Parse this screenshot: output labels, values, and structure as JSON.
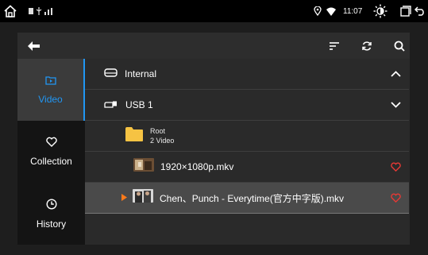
{
  "status_bar": {
    "home_icon": "home-icon",
    "notif_icons": [
      "sim-icon",
      "usb-icon",
      "signal-icon"
    ],
    "location_icon": "location-icon",
    "wifi_icon": "wifi-icon",
    "time": "11:07",
    "brightness_icon": "brightness-icon",
    "window_icon": "window-icon",
    "back_icon": "back-icon"
  },
  "toolbar": {
    "back_icon": "arrow-back-icon",
    "sort_icon": "sort-icon",
    "refresh_icon": "refresh-icon",
    "search_icon": "search-icon"
  },
  "sidebar": {
    "items": [
      {
        "label": "Video",
        "icon": "video-folder-icon",
        "active": true
      },
      {
        "label": "Collection",
        "icon": "heart-icon",
        "active": false
      },
      {
        "label": "History",
        "icon": "clock-icon",
        "active": false
      }
    ]
  },
  "storage": {
    "internal": {
      "label": "Internal",
      "icon": "hard-drive-icon",
      "state_icon": "chevron-up-icon"
    },
    "usb": {
      "label": "USB 1",
      "icon": "usb-drive-icon",
      "state_icon": "chevron-down-icon"
    }
  },
  "folder": {
    "name": "Root",
    "count": "2 Video",
    "icon": "folder-icon"
  },
  "files": [
    {
      "name": "1920×1080p.mkv",
      "favorite_icon": "heart-outline-icon",
      "playing": false
    },
    {
      "name": "Chen、Punch - Everytime(官方中字版).mkv",
      "favorite_icon": "heart-outline-icon",
      "playing": true
    }
  ],
  "colors": {
    "accent": "#2196f3",
    "folder": "#f6c343",
    "favorite": "#e53935",
    "playing": "#ff7a1a"
  }
}
